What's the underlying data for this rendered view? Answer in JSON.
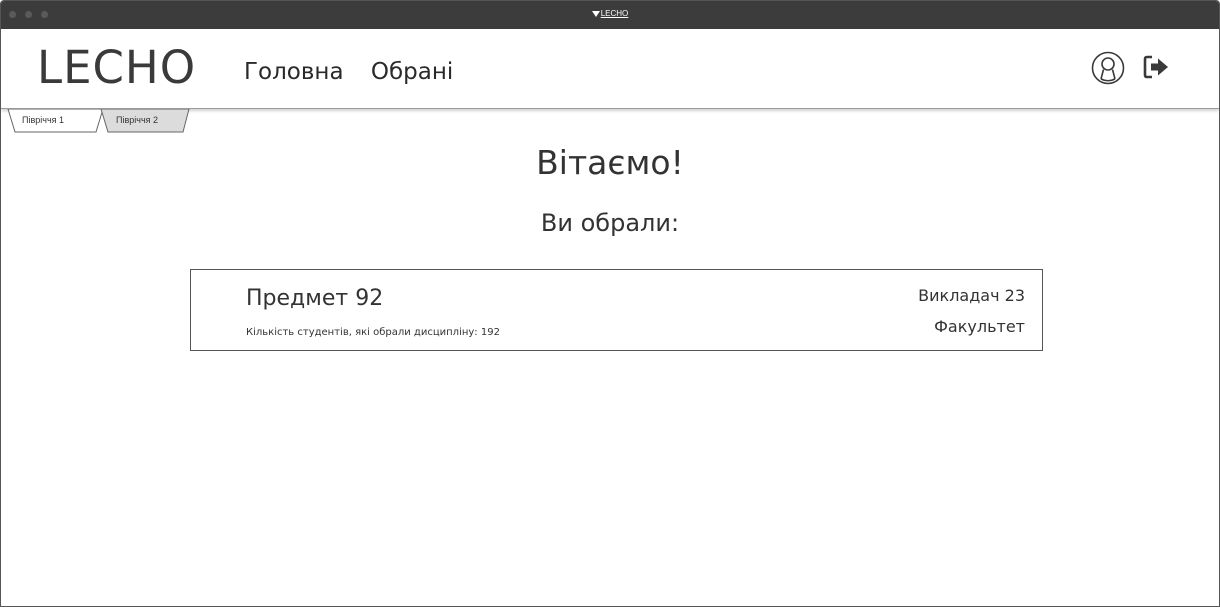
{
  "window": {
    "title": "LECHO"
  },
  "header": {
    "logo": "LECHO",
    "nav": {
      "home": "Головна",
      "favorites": "Обрані"
    },
    "icons": {
      "user": "user-circle-icon",
      "logout": "logout-icon"
    }
  },
  "tabs": [
    {
      "label": "Півріччя 1",
      "selected": true
    },
    {
      "label": "Півріччя 2",
      "selected": false
    }
  ],
  "main": {
    "welcome": "Вітаємо!",
    "subheading": "Ви обрали:",
    "card": {
      "subject": "Предмет 92",
      "students_count": "Кількість студентів,  які обрали дисципліну: 192",
      "teacher": "Викладач 23",
      "faculty": "Факультет"
    }
  },
  "colors": {
    "titlebar": "#3c3c3c",
    "text": "#333333",
    "border": "#555555"
  }
}
